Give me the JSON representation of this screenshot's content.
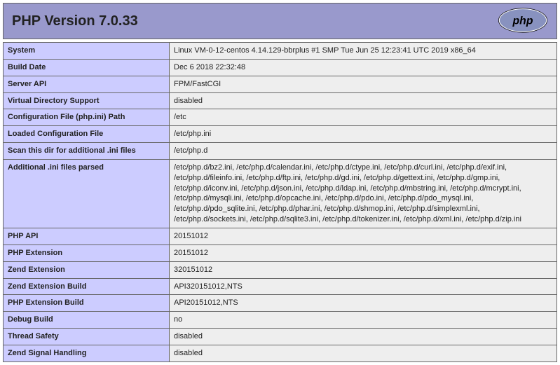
{
  "header": {
    "title": "PHP Version 7.0.33",
    "logo_label": "php"
  },
  "rows": [
    {
      "key": "System",
      "val": "Linux VM-0-12-centos 4.14.129-bbrplus #1 SMP Tue Jun 25 12:23:41 UTC 2019 x86_64"
    },
    {
      "key": "Build Date",
      "val": "Dec 6 2018 22:32:48"
    },
    {
      "key": "Server API",
      "val": "FPM/FastCGI"
    },
    {
      "key": "Virtual Directory Support",
      "val": "disabled"
    },
    {
      "key": "Configuration File (php.ini) Path",
      "val": "/etc"
    },
    {
      "key": "Loaded Configuration File",
      "val": "/etc/php.ini"
    },
    {
      "key": "Scan this dir for additional .ini files",
      "val": "/etc/php.d"
    },
    {
      "key": "Additional .ini files parsed",
      "val": "/etc/php.d/bz2.ini, /etc/php.d/calendar.ini, /etc/php.d/ctype.ini, /etc/php.d/curl.ini, /etc/php.d/exif.ini, /etc/php.d/fileinfo.ini, /etc/php.d/ftp.ini, /etc/php.d/gd.ini, /etc/php.d/gettext.ini, /etc/php.d/gmp.ini, /etc/php.d/iconv.ini, /etc/php.d/json.ini, /etc/php.d/ldap.ini, /etc/php.d/mbstring.ini, /etc/php.d/mcrypt.ini, /etc/php.d/mysqli.ini, /etc/php.d/opcache.ini, /etc/php.d/pdo.ini, /etc/php.d/pdo_mysql.ini, /etc/php.d/pdo_sqlite.ini, /etc/php.d/phar.ini, /etc/php.d/shmop.ini, /etc/php.d/simplexml.ini, /etc/php.d/sockets.ini, /etc/php.d/sqlite3.ini, /etc/php.d/tokenizer.ini, /etc/php.d/xml.ini, /etc/php.d/zip.ini"
    },
    {
      "key": "PHP API",
      "val": "20151012"
    },
    {
      "key": "PHP Extension",
      "val": "20151012"
    },
    {
      "key": "Zend Extension",
      "val": "320151012"
    },
    {
      "key": "Zend Extension Build",
      "val": "API320151012,NTS"
    },
    {
      "key": "PHP Extension Build",
      "val": "API20151012,NTS"
    },
    {
      "key": "Debug Build",
      "val": "no"
    },
    {
      "key": "Thread Safety",
      "val": "disabled"
    },
    {
      "key": "Zend Signal Handling",
      "val": "disabled"
    }
  ]
}
